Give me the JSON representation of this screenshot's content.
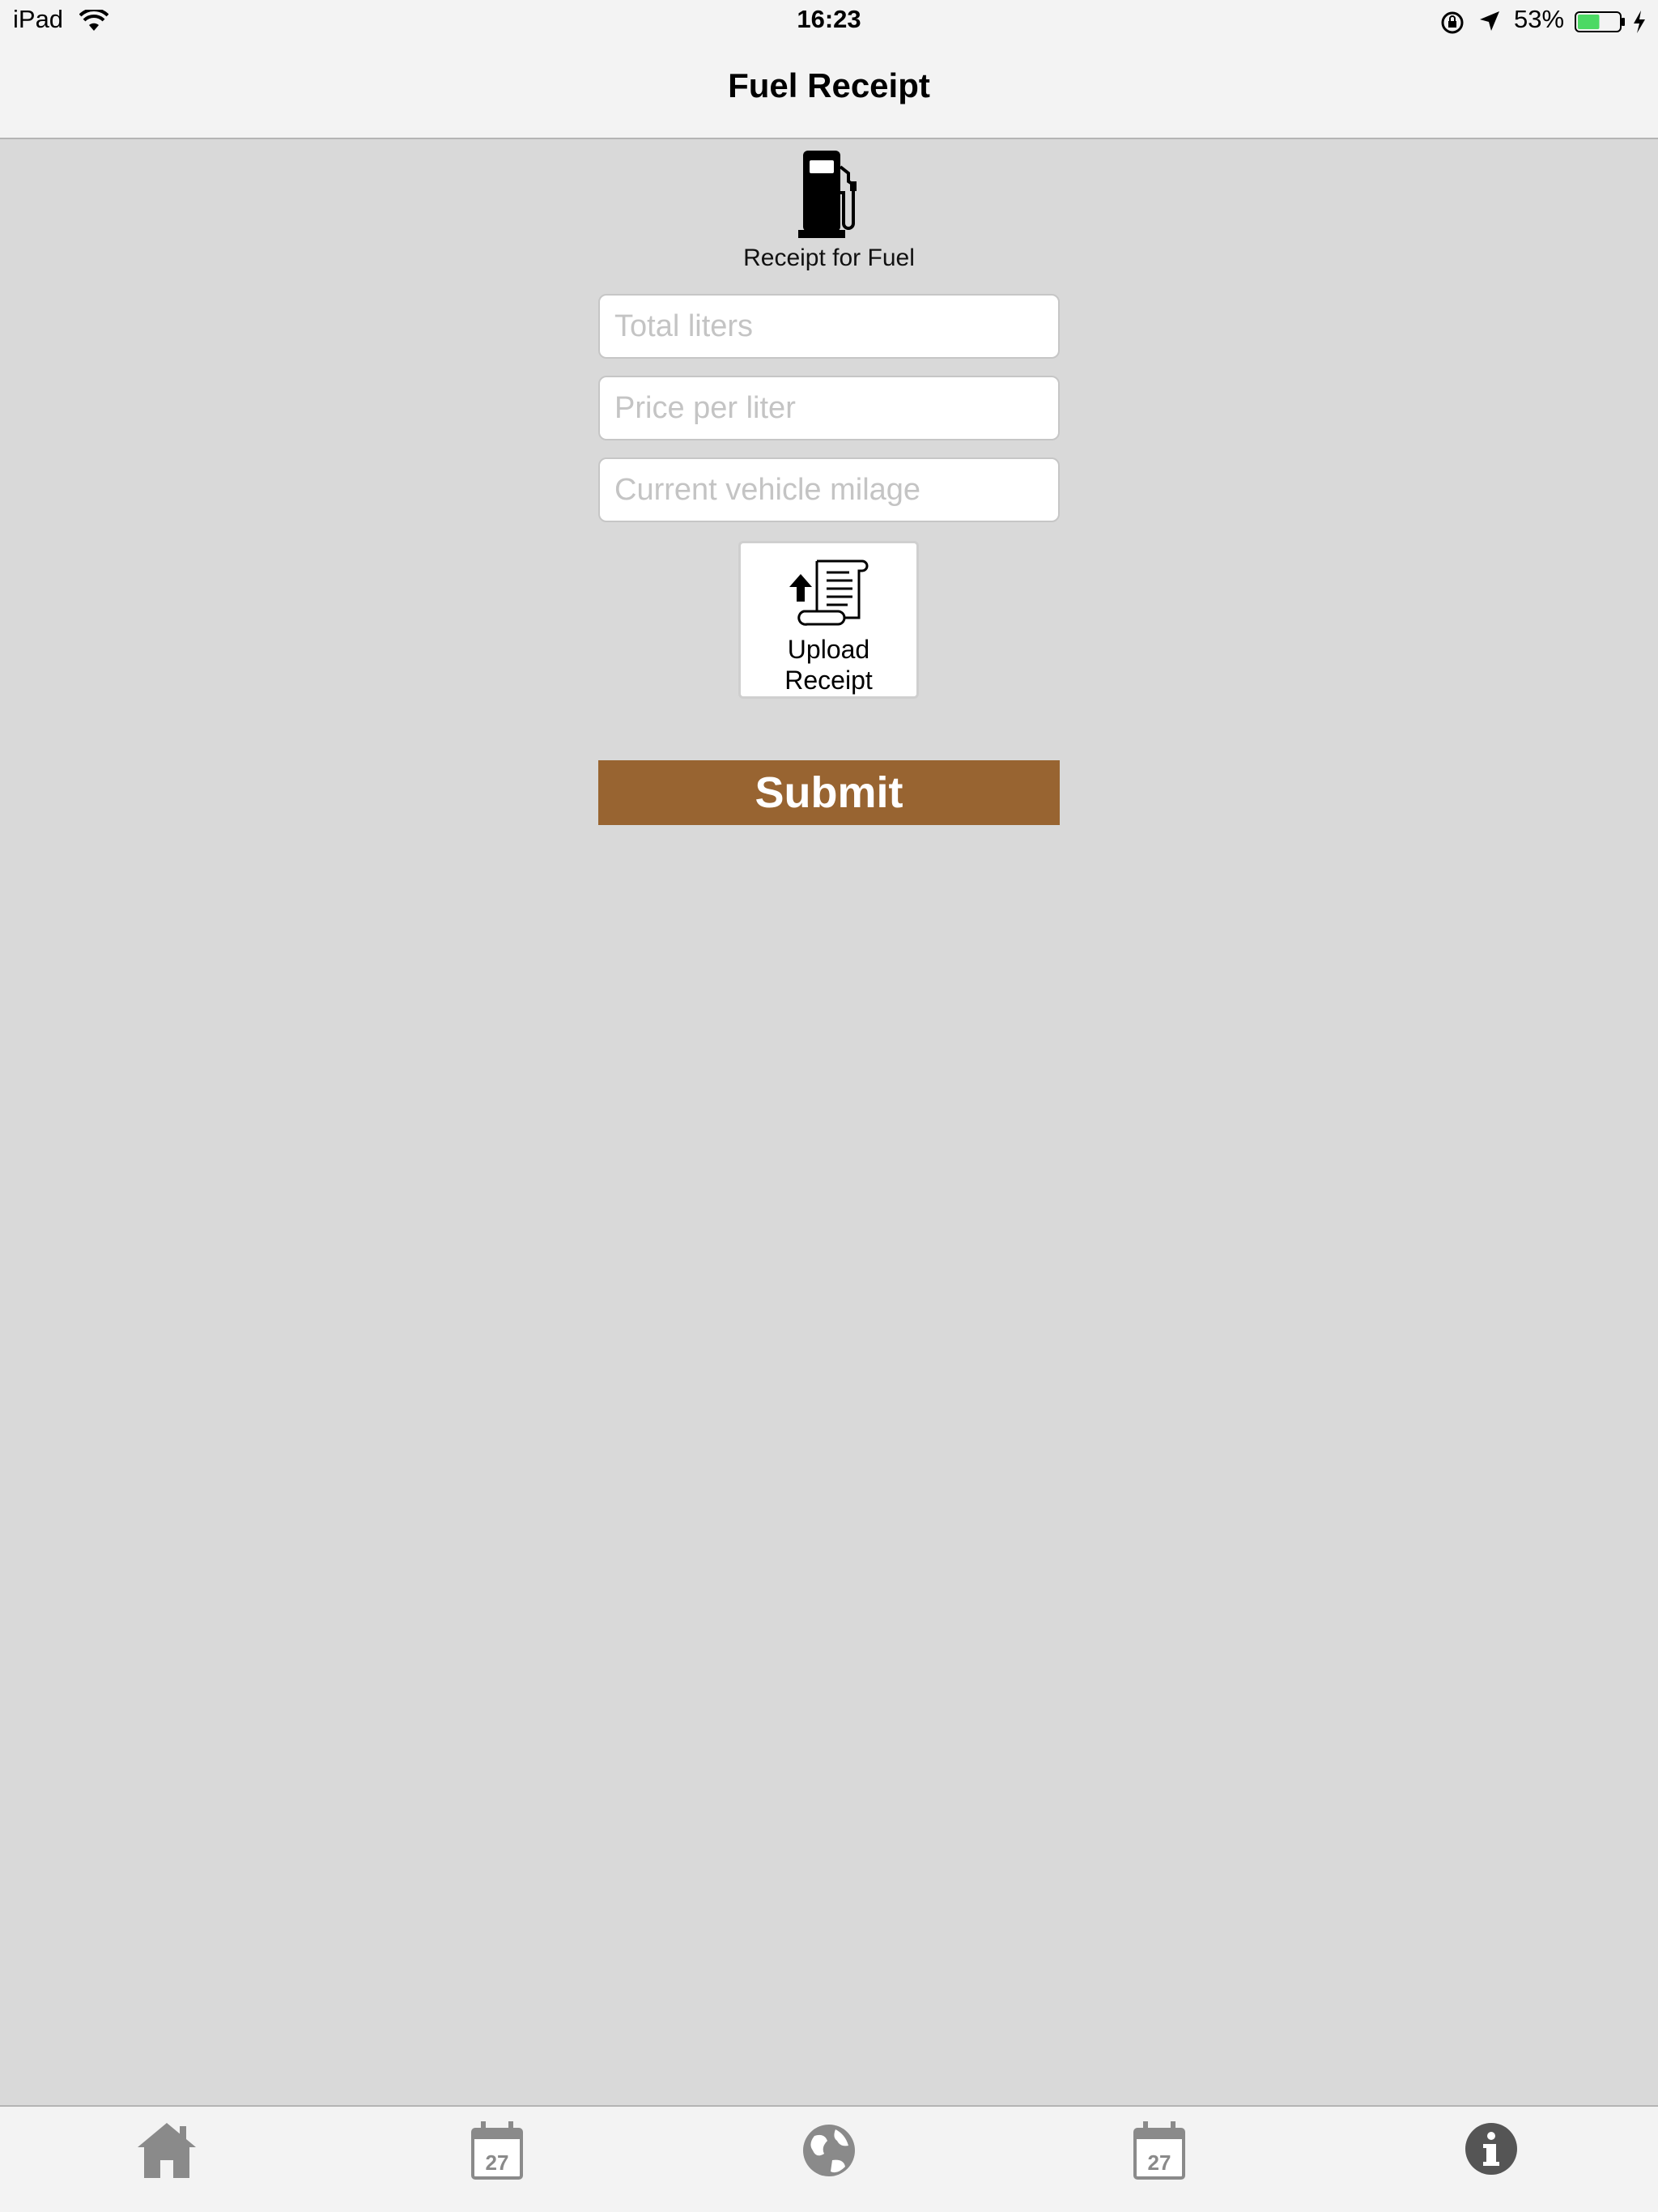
{
  "status_bar": {
    "device": "iPad",
    "time": "16:23",
    "battery_percent": "53%",
    "battery_level": 0.53,
    "battery_color": "#4cd964"
  },
  "nav": {
    "title": "Fuel Receipt"
  },
  "header": {
    "icon": "fuel-pump-icon",
    "caption": "Receipt for Fuel"
  },
  "form": {
    "total_liters": {
      "placeholder": "Total liters",
      "value": ""
    },
    "price_per_liter": {
      "placeholder": "Price per liter",
      "value": ""
    },
    "vehicle_milage": {
      "placeholder": "Current vehicle milage",
      "value": ""
    },
    "upload_button": {
      "line1": "Upload",
      "line2": "Receipt",
      "icon": "upload-receipt-icon"
    },
    "submit_label": "Submit",
    "submit_color": "#986431"
  },
  "tab_bar": {
    "tabs": [
      {
        "icon": "home-icon"
      },
      {
        "icon": "calendar-icon",
        "date": "27"
      },
      {
        "icon": "globe-icon"
      },
      {
        "icon": "calendar-icon",
        "date": "27"
      },
      {
        "icon": "info-icon"
      }
    ]
  }
}
